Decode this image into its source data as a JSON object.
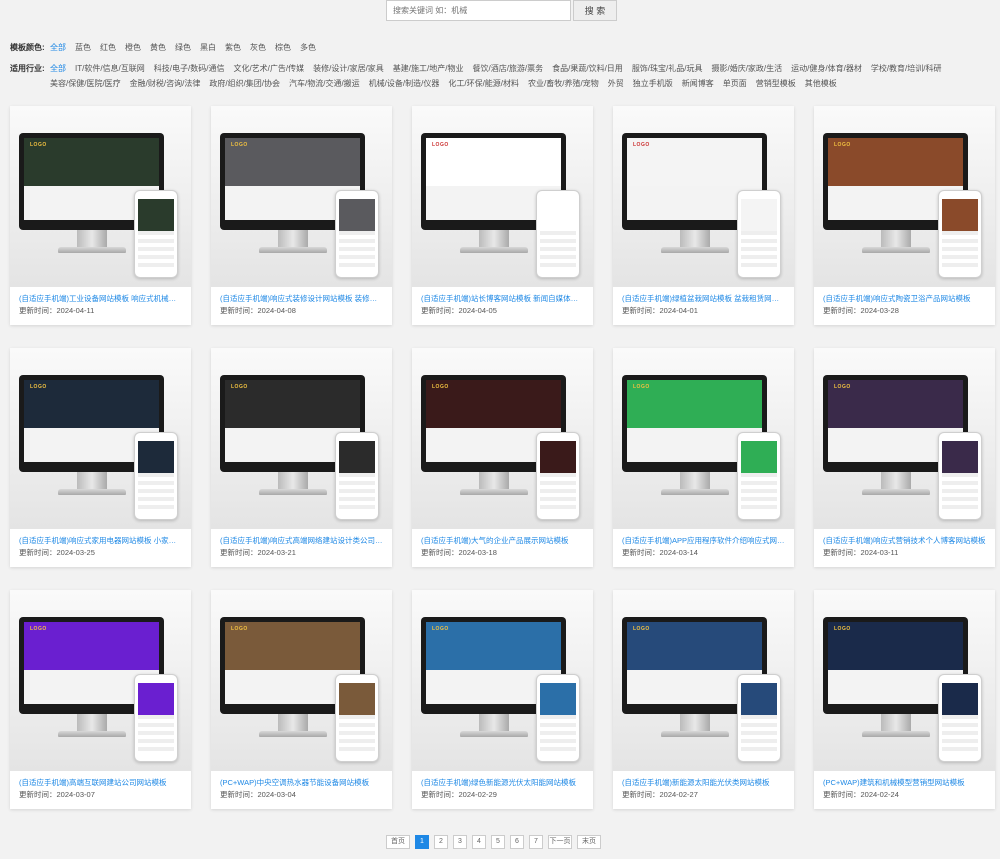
{
  "search": {
    "placeholder": "搜索关键词 如：机械",
    "button": "搜 索"
  },
  "filters": {
    "color_label": "模板颜色:",
    "colors": [
      "全部",
      "蓝色",
      "红色",
      "橙色",
      "黄色",
      "绿色",
      "黑白",
      "紫色",
      "灰色",
      "棕色",
      "多色"
    ],
    "industry_label": "适用行业:",
    "industries": [
      "全部",
      "IT/软件/信息/互联网",
      "科技/电子/数码/通信",
      "文化/艺术/广告/传媒",
      "装修/设计/家居/家具",
      "基建/施工/地产/物业",
      "餐饮/酒店/旅游/票务",
      "食品/果蔬/饮料/日用",
      "服饰/珠宝/礼品/玩具",
      "摄影/婚庆/家政/生活",
      "运动/健身/体育/器材",
      "学校/教育/培训/科研",
      "美容/保健/医院/医疗",
      "金融/财税/咨询/法律",
      "政府/组织/集团/协会",
      "汽车/物流/交通/搬运",
      "机械/设备/制造/仪器",
      "化工/环保/能源/材料",
      "农业/畜牧/养殖/宠物",
      "外贸",
      "独立手机版",
      "新闻博客",
      "单页面",
      "营销型模板",
      "其他模板"
    ]
  },
  "card_colors": [
    "#2a3b2c",
    "#5a5a5e",
    "#ffffff",
    "#f4f4f4",
    "#8a4a2a",
    "#1d2a3a",
    "#2b2b2b",
    "#3a1a1a",
    "#2fae55",
    "#3a2a4a",
    "#6a1fd0",
    "#7a5a3a",
    "#2b6fa8",
    "#264a7a",
    "#1a2a4a"
  ],
  "cards": [
    {
      "title": "(自适应手机端)工业设备网站模板 响应式机械设备网站...",
      "date": "更新时间：2024-04-11"
    },
    {
      "title": "(自适应手机端)响应式装修设计网站模板 装修装潢公司...",
      "date": "更新时间：2024-04-08"
    },
    {
      "title": "(自适应手机端)站长博客网站模板 新闻自媒体博客网站...",
      "date": "更新时间：2024-04-05"
    },
    {
      "title": "(自适应手机端)绿植盆栽网站模板 盆栽租赁网站源码...",
      "date": "更新时间：2024-04-01"
    },
    {
      "title": "(自适应手机端)响应式陶瓷卫浴产品网站模板",
      "date": "更新时间：2024-03-28"
    },
    {
      "title": "(自适应手机端)响应式家用电器网站模板 小家电网站源...",
      "date": "更新时间：2024-03-25"
    },
    {
      "title": "(自适应手机端)响应式高端网络建站设计类公司网站模板",
      "date": "更新时间：2024-03-21"
    },
    {
      "title": "(自适应手机端)大气的企业产品展示网站模板",
      "date": "更新时间：2024-03-18"
    },
    {
      "title": "(自适应手机端)APP应用程序软件介绍响应式网站模板",
      "date": "更新时间：2024-03-14"
    },
    {
      "title": "(自适应手机端)响应式营销技术个人博客网站模板",
      "date": "更新时间：2024-03-11"
    },
    {
      "title": "(自适应手机端)高端互联网建站公司网站模板",
      "date": "更新时间：2024-03-07"
    },
    {
      "title": "(PC+WAP)中央空调热水器节能设备网站模板",
      "date": "更新时间：2024-03-04"
    },
    {
      "title": "(自适应手机端)绿色新能源光伏太阳能网站模板",
      "date": "更新时间：2024-02-29"
    },
    {
      "title": "(自适应手机端)新能源太阳能光伏类网站模板",
      "date": "更新时间：2024-02-27"
    },
    {
      "title": "(PC+WAP)建筑和机械模型营销型网站模板",
      "date": "更新时间：2024-02-24"
    }
  ],
  "logo_text": "LOGO",
  "pager": {
    "first": "首页",
    "pages": [
      "1",
      "2",
      "3",
      "4",
      "5",
      "6",
      "7"
    ],
    "current": "1",
    "next": "下一页",
    "last": "末页"
  }
}
